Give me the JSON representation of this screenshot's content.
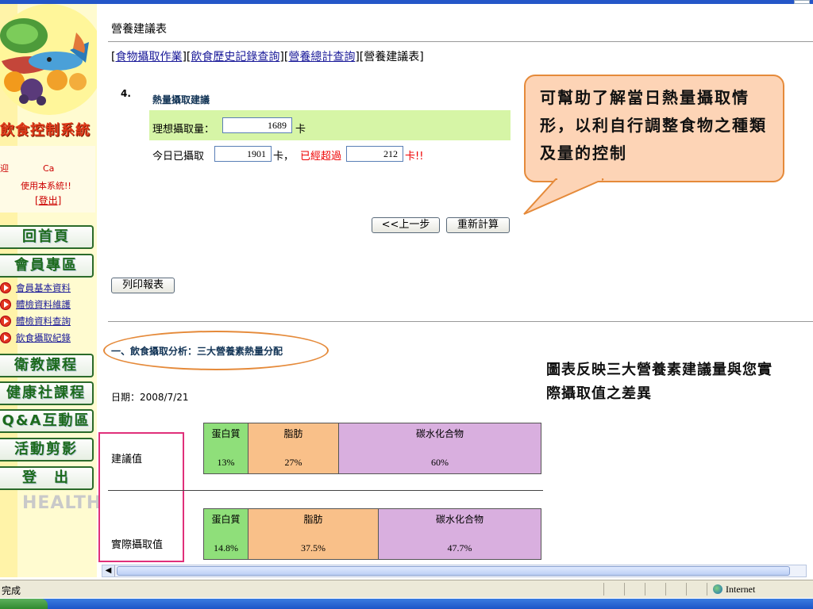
{
  "page": {
    "title": "營養建議表",
    "breadcrumb": [
      {
        "label": "食物攝取作業",
        "link": true
      },
      {
        "label": "飲食歷史記錄查詢",
        "link": true
      },
      {
        "label": "營養總計查詢",
        "link": true
      },
      {
        "label": "營養建議表",
        "link": false
      }
    ]
  },
  "sidebar": {
    "system_title": "飲食控制系統",
    "welcome": "迎",
    "user_name": "Ca",
    "using_text": "使用本系統!!",
    "logout": "[登出]",
    "nav": [
      {
        "label": "回首頁"
      },
      {
        "label": "會員專區"
      },
      {
        "label": "衛教課程"
      },
      {
        "label": "健康社課程"
      },
      {
        "label": "Q&A互動區"
      },
      {
        "label": "活動剪影"
      },
      {
        "label": "登　出"
      }
    ],
    "sub_items": [
      {
        "label": "會員基本資料"
      },
      {
        "label": "體檢資料維護"
      },
      {
        "label": "體檢資料查詢"
      },
      {
        "label": "飲食攝取紀錄"
      }
    ],
    "watermark": "HEALTH"
  },
  "calorie": {
    "number": "4.",
    "heading": "熱量攝取建議",
    "ideal_label": "理想攝取量：",
    "ideal_value": "1689",
    "unit": "卡",
    "today_label": "今日已攝取",
    "today_value": "1901",
    "exceeded_label": "已經超過",
    "comma_unit": "卡，",
    "exceeded_value": "212",
    "exceeded_unit": "卡!!"
  },
  "buttons": {
    "prev": "<<上一步",
    "recalc": "重新計算",
    "print": "列印報表"
  },
  "callout": {
    "text": "可幫助了解當日熱量攝取情形，以利自行調整食物之種類及量的控制"
  },
  "analysis": {
    "title": "一、飲食攝取分析：三大營養素熱量分配",
    "note": "圖表反映三大營養素建議量與您實際攝取值之差異",
    "date": "日期：2008/7/21",
    "rows": [
      {
        "label": "建議值",
        "segments": [
          {
            "name": "蛋白質",
            "value": "13%",
            "color": "#8fdf7a"
          },
          {
            "name": "脂肪",
            "value": "27%",
            "color": "#f9c089"
          },
          {
            "name": "碳水化合物",
            "value": "60%",
            "color": "#d9afdf"
          }
        ]
      },
      {
        "label": "實際攝取值",
        "segments": [
          {
            "name": "蛋白質",
            "value": "14.8%",
            "color": "#8fdf7a"
          },
          {
            "name": "脂肪",
            "value": "37.5%",
            "color": "#f9c089"
          },
          {
            "name": "碳水化合物",
            "value": "47.7%",
            "color": "#d9afdf"
          }
        ]
      }
    ]
  },
  "statusbar": {
    "status": "完成",
    "zone": "Internet"
  }
}
